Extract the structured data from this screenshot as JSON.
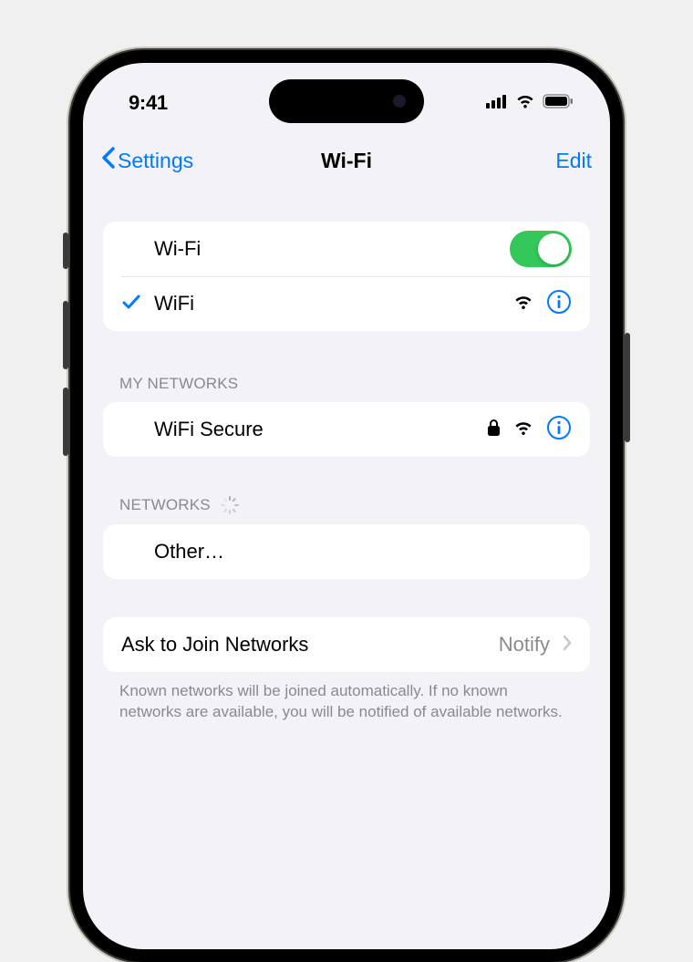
{
  "status": {
    "time": "9:41"
  },
  "nav": {
    "back_label": "Settings",
    "title": "Wi-Fi",
    "edit_label": "Edit"
  },
  "wifi_toggle": {
    "label": "Wi-Fi",
    "on": true
  },
  "connected_network": {
    "name": "WiFi",
    "locked": false
  },
  "sections": {
    "my_networks": {
      "header": "My Networks",
      "items": [
        {
          "name": "WiFi Secure",
          "locked": true
        }
      ]
    },
    "other_networks": {
      "header": "Networks",
      "loading": true,
      "other_label": "Other…"
    }
  },
  "ask_to_join": {
    "label": "Ask to Join Networks",
    "value": "Notify",
    "footer": "Known networks will be joined automatically. If no known networks are available, you will be notified of available networks."
  },
  "colors": {
    "accent": "#007aff",
    "toggle_on": "#34c759",
    "bg": "#f2f2f7"
  }
}
